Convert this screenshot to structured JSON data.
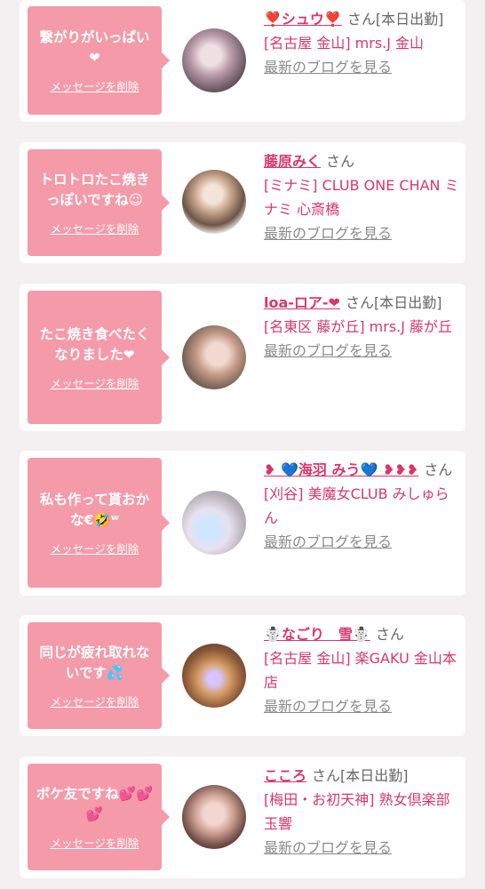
{
  "cards": [
    {
      "message": "繋がりがいっぱい❤",
      "delete_label": "メッセージを削除",
      "name": "❣️シュウ❣️",
      "honorific": "さん[本日出勤]",
      "shop": "[名古屋 金山] mrs.J 金山",
      "blog": "最新のブログを見る"
    },
    {
      "message": "トロトロたこ焼きっぽいですね☺",
      "delete_label": "メッセージを削除",
      "name": "藤原みく",
      "honorific": "さん",
      "shop": "[ミナミ] CLUB ONE CHAN ミナミ 心斎橋",
      "blog": "最新のブログを見る"
    },
    {
      "message": "たこ焼き食べたくなりました❤",
      "delete_label": "メッセージを削除",
      "name": "loa-ロア-❤",
      "honorific": "さん[本日出勤]",
      "shop": "[名東区 藤が丘] mrs.J 藤が丘",
      "blog": "最新のブログを見る"
    },
    {
      "message": "私も作って貰おかな€🤣ʷ",
      "delete_label": "メッセージを削除",
      "name": "❥ 💙海羽 みう💙 ❥❥❥",
      "honorific": "さん",
      "shop": "[刈谷] 美魔女CLUB みしゅらん",
      "blog": "最新のブログを見る"
    },
    {
      "message": "同じが疲れ取れないです💦",
      "delete_label": "メッセージを削除",
      "name": "☃️なごり　雪☃️",
      "honorific": "さん",
      "shop": "[名古屋 金山] 楽GAKU 金山本店",
      "blog": "最新のブログを見る"
    },
    {
      "message": "ボケ友ですね💕💕💕",
      "delete_label": "メッセージを削除",
      "name": "こころ",
      "honorific": "さん[本日出勤]",
      "shop": "[梅田・お初天神] 熟女倶楽部 玉響",
      "blog": "最新のブログを見る"
    }
  ]
}
